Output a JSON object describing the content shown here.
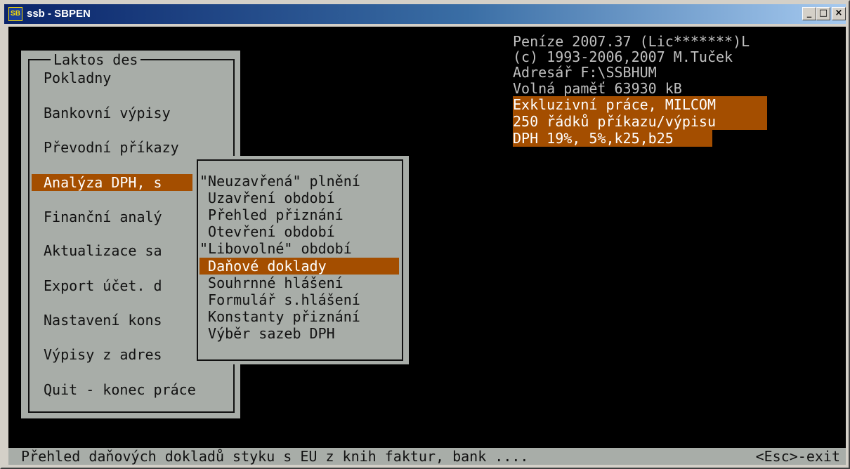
{
  "window": {
    "title": "ssb - SBPEN",
    "icon": "SB",
    "minimize_glyph": "_",
    "maximize_glyph": "□",
    "close_glyph": "×"
  },
  "info": {
    "lines": [
      "Peníze 2007.37 (Lic*******)L",
      "(c) 1993-2006,2007 M.Tuček",
      "Adresář F:\\SSBHUM",
      "Volná paměť 63930 kB"
    ],
    "highlight_lines": [
      "Exkluzivní práce, MILCOM",
      "250 řádků příkazu/výpisu",
      "DPH 19%, 5%,k25,b25"
    ]
  },
  "main_menu": {
    "title": "Laktos des",
    "items": [
      "Pokladny",
      "Bankovní výpisy",
      "Převodní příkazy",
      "Analýza DPH, s",
      "Finanční analý",
      "Aktualizace sa",
      "Export účet. d",
      "Nastavení kons",
      "Výpisy z adres",
      "Quit - konec práce"
    ],
    "selected_index": 3
  },
  "submenu": {
    "items": [
      "\"Neuzavřená\" plnění",
      " Uzavření období",
      " Přehled přiznání",
      " Otevření období",
      "\"Libovolné\" období",
      " Daňové doklady",
      " Souhrnné hlášení",
      " Formulář s.hlášení",
      " Konstanty přiznání",
      " Výběr sazeb DPH"
    ],
    "selected_index": 5
  },
  "status": {
    "text": "Přehled daňových dokladů styku s EU z knih faktur, bank ....",
    "exit": "<Esc>-exit"
  },
  "colors": {
    "screen_bg": "#000000",
    "panel_bg": "#a8ada8",
    "highlight": "#a44e00",
    "info_text": "#c0c0c0"
  }
}
